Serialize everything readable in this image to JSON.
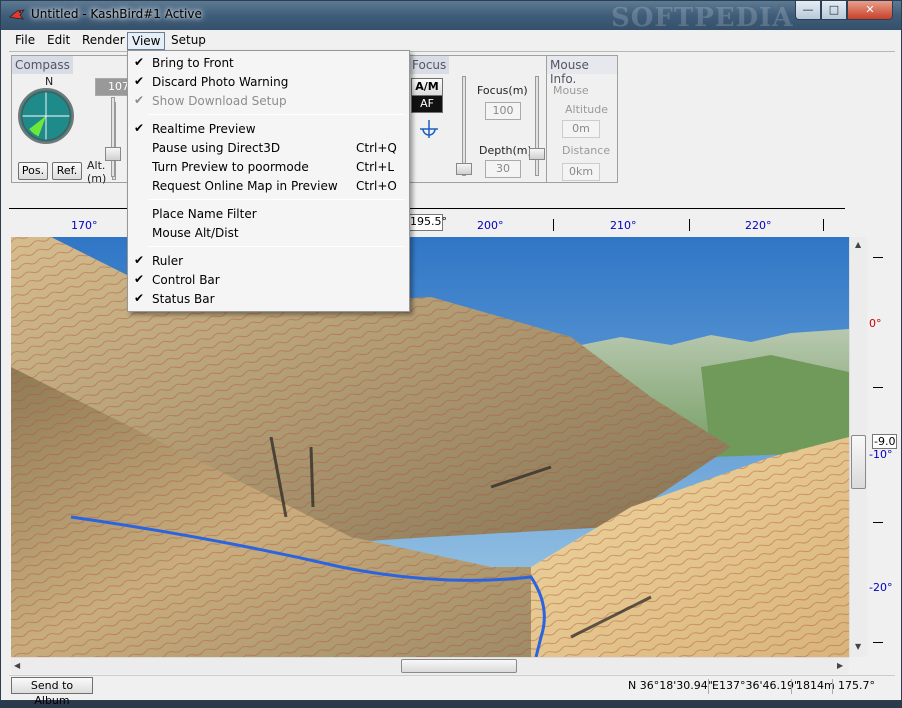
{
  "window": {
    "title": "Untitled - KashBird#1 Active",
    "watermark": "SOFTPEDIA",
    "buttons": {
      "minimize": "—",
      "maximize": "□",
      "close": "✕"
    }
  },
  "menubar": {
    "file": "File",
    "edit": "Edit",
    "render": "Render",
    "view": "View",
    "setup": "Setup"
  },
  "view_menu": {
    "items": [
      {
        "label": "Bring to Front",
        "checked": true,
        "shortcut": ""
      },
      {
        "label": "Discard Photo Warning",
        "checked": true,
        "shortcut": ""
      },
      {
        "label": "Show Download Setup",
        "checked": true,
        "shortcut": "",
        "disabled": true
      },
      {
        "label": "Realtime Preview",
        "checked": true,
        "shortcut": ""
      },
      {
        "label": "Pause using Direct3D",
        "checked": false,
        "shortcut": "Ctrl+Q"
      },
      {
        "label": "Turn Preview to poormode",
        "checked": false,
        "shortcut": "Ctrl+L"
      },
      {
        "label": "Request Online Map in Preview",
        "checked": false,
        "shortcut": "Ctrl+O"
      },
      {
        "label": "Place Name Filter",
        "checked": false,
        "shortcut": ""
      },
      {
        "label": "Mouse Alt/Dist",
        "checked": false,
        "shortcut": ""
      },
      {
        "label": "Ruler",
        "checked": true,
        "shortcut": ""
      },
      {
        "label": "Control Bar",
        "checked": true,
        "shortcut": ""
      },
      {
        "label": "Status Bar",
        "checked": true,
        "shortcut": ""
      }
    ],
    "check_glyph": "✔"
  },
  "panel": {
    "compass": {
      "title": "Compass",
      "north": "N",
      "pos_button": "Pos.",
      "ref_button": "Ref.",
      "alt_label": "Alt.",
      "alt_unit": "(m)",
      "alt_value_partial": "107"
    },
    "focus": {
      "title": "Focus",
      "am_button": "A/M",
      "af_button": "AF",
      "focus_label": "Focus(m)",
      "focus_value": "100",
      "depth_label": "Depth(m)",
      "depth_value": "30"
    },
    "mouse_info": {
      "title": "Mouse Info.",
      "mouse_label": "Mouse",
      "altitude_label": "Altitude",
      "altitude_value": "0m",
      "distance_label": "Distance",
      "distance_value": "0km"
    }
  },
  "ruler": {
    "ticks": [
      "170°",
      "",
      "",
      "195.5°",
      "200°",
      "",
      "210°",
      "",
      "220°",
      ""
    ],
    "heading_marker": "195.5°",
    "labels": [
      {
        "text": "170°"
      },
      {
        "text": "200°"
      },
      {
        "text": "210°"
      },
      {
        "text": "220°"
      }
    ],
    "vertical": [
      {
        "text": "0°",
        "color": "#cc0000"
      },
      {
        "text": "-9.0",
        "color": "#000000"
      },
      {
        "text": "-10°",
        "color": "#0000c0"
      },
      {
        "text": "-20°",
        "color": "#0000c0"
      }
    ]
  },
  "status": {
    "send_button": "Send to Album",
    "latitude": "N 36°18'30.94\"",
    "longitude": "E137°36'46.19\"",
    "altitude": "1814m",
    "heading": "175.7°"
  },
  "colors": {
    "accent": "#1f8a8a",
    "ruler_blue": "#0000c0",
    "zero_red": "#cc0000",
    "sky": "#3d7fbf",
    "terrain": "#b89a6a"
  }
}
